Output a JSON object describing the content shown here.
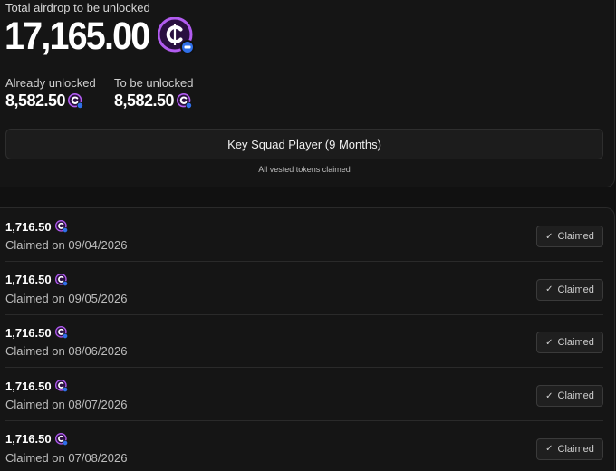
{
  "summary": {
    "total_label": "Total airdrop to be unlocked",
    "total_value": "17,165.00",
    "already_unlocked_label": "Already unlocked",
    "already_unlocked_value": "8,582.50",
    "to_be_unlocked_label": "To be unlocked",
    "to_be_unlocked_value": "8,582.50",
    "tier_button_label": "Key Squad Player (9 Months)",
    "vested_note": "All vested tokens claimed"
  },
  "token_icon": "token-coin-icon",
  "colors": {
    "background": "#111111",
    "card": "#151515",
    "coin_purple": "#b25cf0",
    "coin_badge_blue": "#2f6fe8"
  },
  "claims": [
    {
      "amount": "1,716.50",
      "date": "Claimed on 09/04/2026",
      "status": "Claimed"
    },
    {
      "amount": "1,716.50",
      "date": "Claimed on 09/05/2026",
      "status": "Claimed"
    },
    {
      "amount": "1,716.50",
      "date": "Claimed on 08/06/2026",
      "status": "Claimed"
    },
    {
      "amount": "1,716.50",
      "date": "Claimed on 08/07/2026",
      "status": "Claimed"
    },
    {
      "amount": "1,716.50",
      "date": "Claimed on 07/08/2026",
      "status": "Claimed"
    }
  ]
}
